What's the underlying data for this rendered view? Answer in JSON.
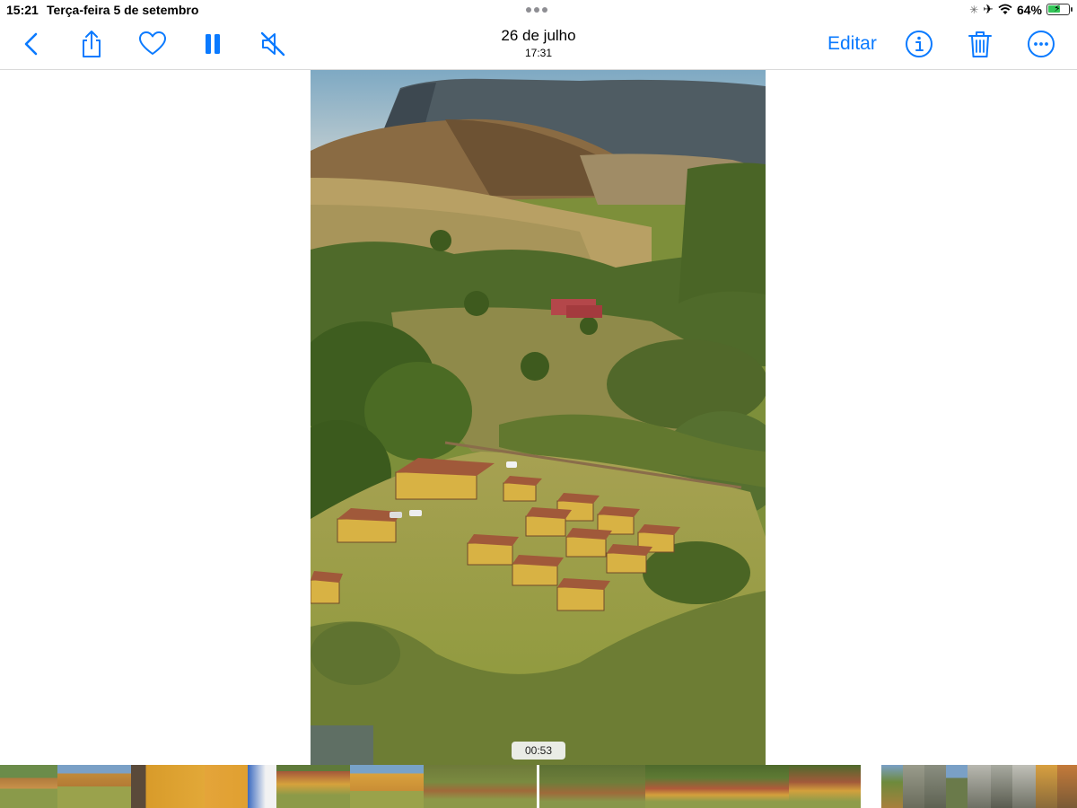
{
  "status_bar": {
    "time": "15:21",
    "date": "Terça-feira 5 de setembro",
    "battery_percent": "64%",
    "battery_level": 0.64
  },
  "toolbar": {
    "title": "26 de julho",
    "subtitle": "17:31",
    "edit_label": "Editar",
    "accent_color": "#0a7aff",
    "icons": [
      "back-chevron-icon",
      "share-icon",
      "heart-icon",
      "pause-icon",
      "mute-icon",
      "info-icon",
      "trash-icon",
      "more-icon"
    ]
  },
  "video": {
    "timestamp": "00:53"
  }
}
